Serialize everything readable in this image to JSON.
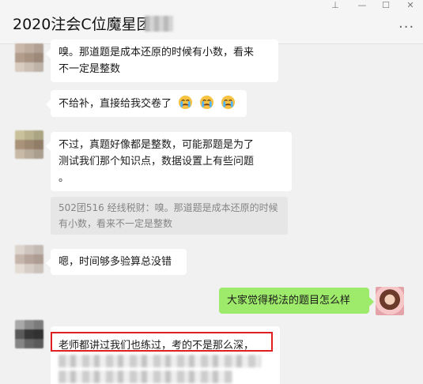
{
  "window": {
    "title": "2020注会C位魔星团",
    "controls": {
      "pin": "⊥",
      "minimize": "—",
      "maximize": "☐",
      "close": "✕"
    },
    "menu_icon": "more-dots-icon"
  },
  "messages": [
    {
      "text_line1": "嗅。那道题是成本还原的时候有小数，看来",
      "text_line2": "不一定是整数"
    },
    {
      "text": "不给补，直接给我交卷了",
      "emojis": [
        "crying-face-icon",
        "crying-face-icon",
        "crying-face-icon"
      ]
    },
    {
      "text_line1": "不过，真题好像都是整数，可能那题是为了",
      "text_line2": "测试我们那个知识点，数据设置上有些问题",
      "text_line3": "。"
    },
    {
      "quote_line1": "502团516 经线税财：嗅。那道题是成本还原的时候",
      "quote_line2": "有小数，看来不一定是整数"
    },
    {
      "text": "嗯，时间够多验算总没错"
    },
    {
      "text": "大家觉得税法的题目怎么样"
    },
    {
      "text_line1": "老师都讲过我们也练过，考的不是那么深，"
    }
  ],
  "colors": {
    "self_bubble": "#9eea6a",
    "other_bubble": "#ffffff",
    "highlight": "#e02020",
    "background": "#f1f1f1"
  }
}
